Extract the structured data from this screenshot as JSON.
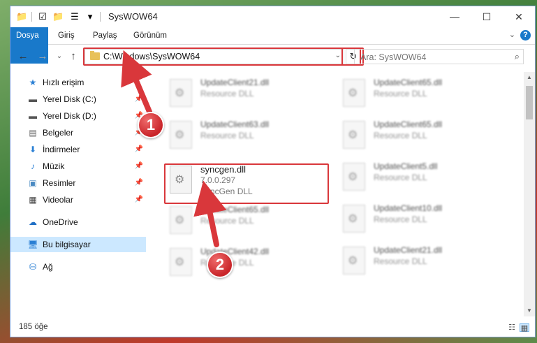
{
  "window": {
    "title": "SysWOW64",
    "minimize": "—",
    "maximize": "☐",
    "close": "✕"
  },
  "ribbon": {
    "tabs": [
      "Dosya",
      "Giriş",
      "Paylaş",
      "Görünüm"
    ],
    "help": "?",
    "expand": "⌄"
  },
  "nav": {
    "back": "←",
    "forward": "→",
    "recent": "⌄",
    "up": "↑",
    "path": "C:\\Windows\\SysWOW64",
    "refresh": "↻",
    "search_placeholder": "Ara: SysWOW64",
    "search_icon": "⌕"
  },
  "sidebar": {
    "items": [
      {
        "label": "Hızlı erişim",
        "icon": "star-icon",
        "pinned": false
      },
      {
        "label": "Yerel Disk (C:)",
        "icon": "drive-icon",
        "pinned": true
      },
      {
        "label": "Yerel Disk (D:)",
        "icon": "drive-icon",
        "pinned": true
      },
      {
        "label": "Belgeler",
        "icon": "documents-icon",
        "pinned": true
      },
      {
        "label": "İndirmeler",
        "icon": "download-icon",
        "pinned": true
      },
      {
        "label": "Müzik",
        "icon": "music-icon",
        "pinned": true
      },
      {
        "label": "Resimler",
        "icon": "pictures-icon",
        "pinned": true
      },
      {
        "label": "Videolar",
        "icon": "video-icon",
        "pinned": true
      },
      {
        "label": "OneDrive",
        "icon": "cloud-icon",
        "pinned": false
      },
      {
        "label": "Bu bilgisayar",
        "icon": "computer-icon",
        "pinned": false,
        "selected": true
      },
      {
        "label": "Ağ",
        "icon": "network-icon",
        "pinned": false
      }
    ]
  },
  "files": {
    "left": [
      {
        "name": "UpdateClient21.dll",
        "desc": "Resource DLL"
      },
      {
        "name": "UpdateClient63.dll",
        "desc": "Resource DLL"
      },
      {
        "name": "UpdateClient65.dll",
        "desc": "Resource DLL"
      },
      {
        "name": "UpdateClient42.dll",
        "desc": "Resource DLL"
      }
    ],
    "right": [
      {
        "name": "UpdateClient65.dll",
        "desc": "Resource DLL"
      },
      {
        "name": "UpdateClient65.dll",
        "desc": "Resource DLL"
      },
      {
        "name": "UpdateClient5.dll",
        "desc": "Resource DLL"
      },
      {
        "name": "UpdateClient10.dll",
        "desc": "Resource DLL"
      },
      {
        "name": "UpdateClient21.dll",
        "desc": "Resource DLL"
      }
    ],
    "selected": {
      "name": "syncgen.dll",
      "version": "7.0.0.297",
      "desc": "SyncGen DLL"
    }
  },
  "status": {
    "count": "185 öğe"
  },
  "callouts": {
    "step1": "1",
    "step2": "2",
    "color": "#d9373b"
  }
}
